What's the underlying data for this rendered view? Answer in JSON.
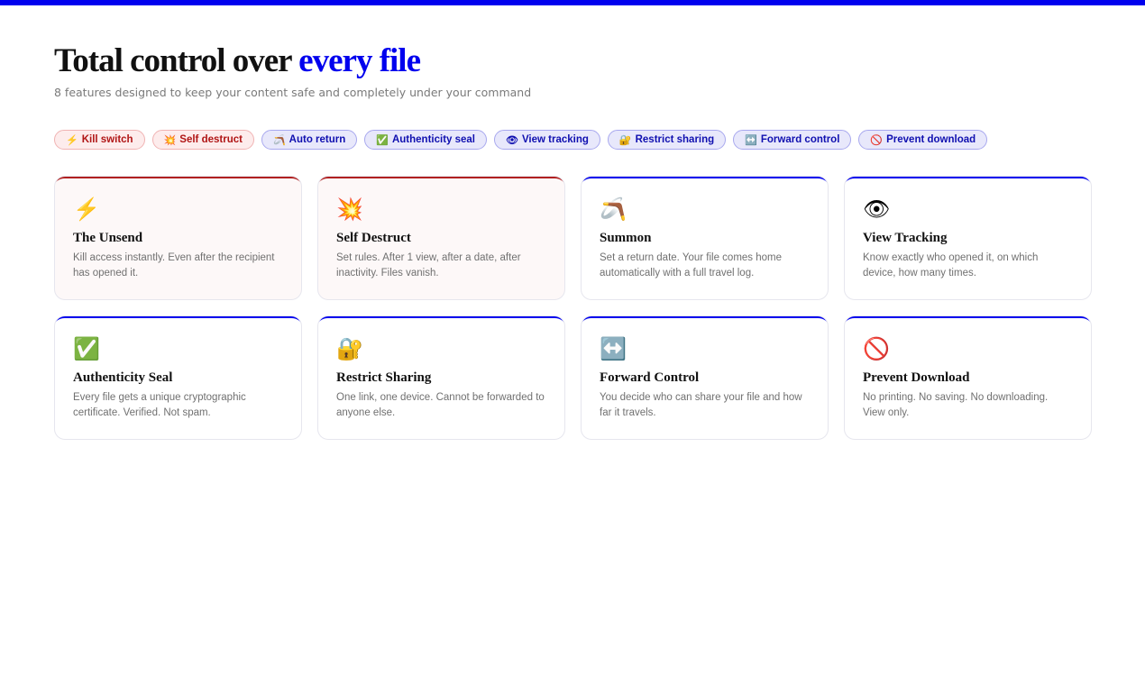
{
  "header": {
    "title_main": "Total control over ",
    "title_accent": "every file",
    "subtitle": "8 features designed to keep your content safe and completely under your command"
  },
  "pills": [
    {
      "icon": "⚡",
      "icon_name": "lightning-icon",
      "label": "Kill switch",
      "tone": "red"
    },
    {
      "icon": "💥",
      "icon_name": "explosion-icon",
      "label": "Self destruct",
      "tone": "red"
    },
    {
      "icon": "🪃",
      "icon_name": "boomerang-icon",
      "label": "Auto return",
      "tone": "blue"
    },
    {
      "icon": "✅",
      "icon_name": "checkmark-icon",
      "label": "Authenticity seal",
      "tone": "blue"
    },
    {
      "icon": "👁",
      "icon_name": "eye-icon",
      "label": "View tracking",
      "tone": "blue"
    },
    {
      "icon": "🔐",
      "icon_name": "lock-key-icon",
      "label": "Restrict sharing",
      "tone": "blue"
    },
    {
      "icon": "↔️",
      "icon_name": "left-right-arrow-icon",
      "label": "Forward control",
      "tone": "blue"
    },
    {
      "icon": "🚫",
      "icon_name": "prohibited-icon",
      "label": "Prevent download",
      "tone": "blue"
    }
  ],
  "cards": [
    {
      "icon": "⚡",
      "icon_name": "lightning-icon",
      "title": "The Unsend",
      "desc": "Kill access instantly. Even after the recipient has opened it.",
      "tone": "red"
    },
    {
      "icon": "💥",
      "icon_name": "explosion-icon",
      "title": "Self Destruct",
      "desc": "Set rules. After 1 view, after a date, after inactivity. Files vanish.",
      "tone": "red"
    },
    {
      "icon": "🪃",
      "icon_name": "boomerang-icon",
      "title": "Summon",
      "desc": "Set a return date. Your file comes home automatically with a full travel log.",
      "tone": "blue"
    },
    {
      "icon": "👁",
      "icon_name": "eye-icon",
      "title": "View Tracking",
      "desc": "Know exactly who opened it, on which device, how many times.",
      "tone": "blue"
    },
    {
      "icon": "✅",
      "icon_name": "checkmark-icon",
      "title": "Authenticity Seal",
      "desc": "Every file gets a unique cryptographic certificate. Verified. Not spam.",
      "tone": "blue"
    },
    {
      "icon": "🔐",
      "icon_name": "lock-key-icon",
      "title": "Restrict Sharing",
      "desc": "One link, one device. Cannot be forwarded to anyone else.",
      "tone": "blue"
    },
    {
      "icon": "↔️",
      "icon_name": "left-right-arrow-icon",
      "title": "Forward Control",
      "desc": "You decide who can share your file and how far it travels.",
      "tone": "blue"
    },
    {
      "icon": "🚫",
      "icon_name": "prohibited-icon",
      "title": "Prevent Download",
      "desc": "No printing. No saving. No downloading. View only.",
      "tone": "blue"
    }
  ],
  "colors": {
    "accent": "#0000ee",
    "danger": "#b02020"
  }
}
